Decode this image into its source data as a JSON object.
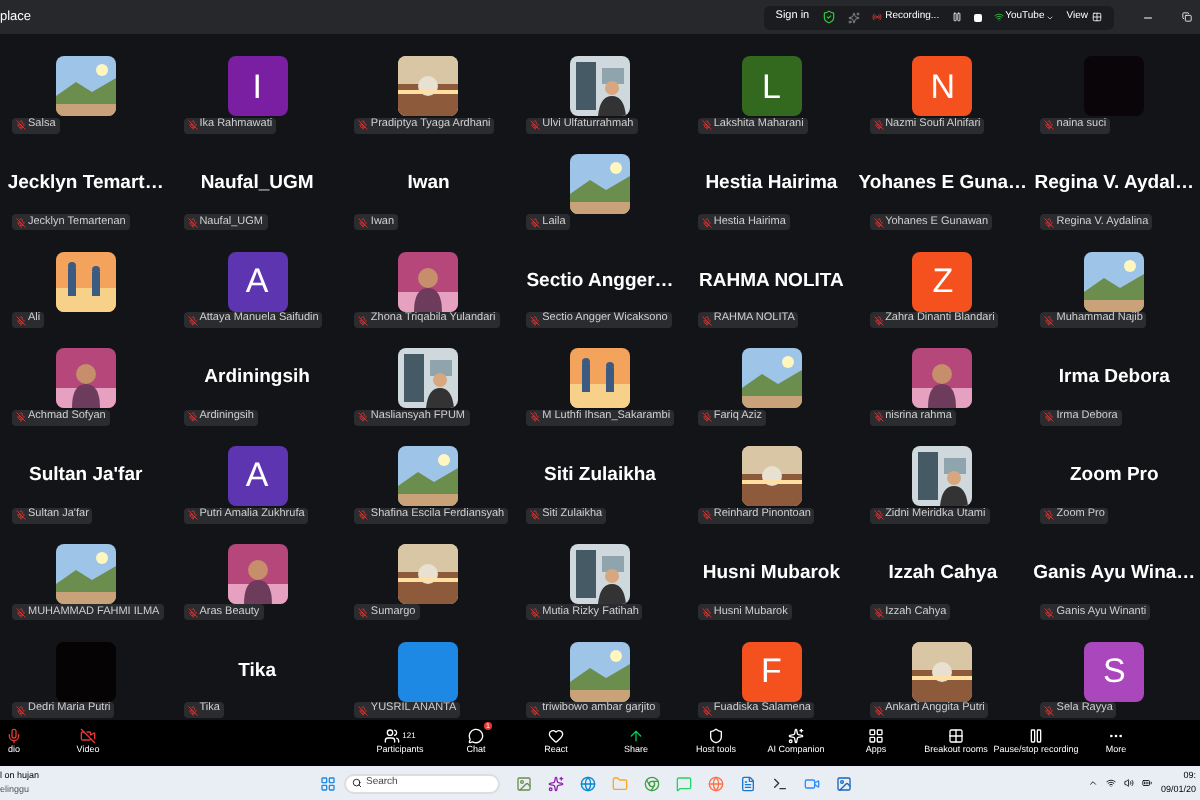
{
  "window": {
    "title": "place"
  },
  "meeting_bar": {
    "sign_in": "Sign in",
    "recording": "Recording...",
    "stream": "YouTube",
    "view": "View"
  },
  "tiles": [
    {
      "kind": "picture",
      "label": "Salsa"
    },
    {
      "kind": "avatar",
      "letter": "I",
      "color": "#7b1fa2",
      "label": "Ika Rahmawati"
    },
    {
      "kind": "picture",
      "label": "Pradiptya Tyaga Ardhani"
    },
    {
      "kind": "picture",
      "label": "Ulvi Ulfaturrahmah"
    },
    {
      "kind": "avatar",
      "letter": "L",
      "color": "#33691e",
      "label": "Lakshita Maharani"
    },
    {
      "kind": "avatar",
      "letter": "N",
      "color": "#f4511e",
      "label": "Nazmi Soufi Alnifari"
    },
    {
      "kind": "blank",
      "color": "#0a0508",
      "label": "naina suci"
    },
    {
      "kind": "name",
      "name": "Jecklyn Temart…",
      "label": "Jecklyn Temartenan"
    },
    {
      "kind": "name",
      "name": "Naufal_UGM",
      "label": "Naufal_UGM"
    },
    {
      "kind": "name",
      "name": "Iwan",
      "label": "Iwan"
    },
    {
      "kind": "picture",
      "label": "Laila"
    },
    {
      "kind": "name",
      "name": "Hestia Hairima",
      "label": "Hestia Hairima"
    },
    {
      "kind": "name",
      "name": "Yohanes E Guna…",
      "label": "Yohanes E Gunawan"
    },
    {
      "kind": "name",
      "name": "Regina V. Aydal…",
      "label": "Regina V. Aydalina"
    },
    {
      "kind": "picture",
      "label": "Ali"
    },
    {
      "kind": "avatar",
      "letter": "A",
      "color": "#5e35b1",
      "label": "Attaya Manuela Saifudin"
    },
    {
      "kind": "picture",
      "label": "Zhona Triqabila Yulandari"
    },
    {
      "kind": "name",
      "name": "Sectio Angger…",
      "label": "Sectio Angger Wicaksono"
    },
    {
      "kind": "name",
      "name": "RAHMA NOLITA",
      "label": "RAHMA NOLITA"
    },
    {
      "kind": "avatar",
      "letter": "Z",
      "color": "#f4511e",
      "label": "Zahra Dinanti Blandari"
    },
    {
      "kind": "picture",
      "label": "Muhammad Najib"
    },
    {
      "kind": "picture",
      "label": "Achmad Sofyan"
    },
    {
      "kind": "name",
      "name": "Ardiningsih",
      "label": "Ardiningsih"
    },
    {
      "kind": "picture",
      "label": "Nasliansyah FPUM"
    },
    {
      "kind": "picture",
      "label": "M Luthfi Ihsan_Sakarambi"
    },
    {
      "kind": "picture",
      "label": "Fariq Aziz"
    },
    {
      "kind": "picture",
      "label": "nisrina rahma"
    },
    {
      "kind": "name",
      "name": "Irma Debora",
      "label": "Irma Debora"
    },
    {
      "kind": "name",
      "name": "Sultan Ja'far",
      "label": "Sultan Ja'far"
    },
    {
      "kind": "avatar",
      "letter": "A",
      "color": "#5e35b1",
      "label": "Putri Amalia Zukhrufa"
    },
    {
      "kind": "picture",
      "label": "Shafina Escila Ferdiansyah"
    },
    {
      "kind": "name",
      "name": "Siti Zulaikha",
      "label": "Siti Zulaikha"
    },
    {
      "kind": "picture",
      "label": "Reinhard Pinontoan"
    },
    {
      "kind": "picture",
      "label": "Zidni Meiridka Utami"
    },
    {
      "kind": "name",
      "name": "Zoom Pro",
      "label": "Zoom Pro"
    },
    {
      "kind": "picture",
      "label": "MUHAMMAD FAHMI ILMA"
    },
    {
      "kind": "picture",
      "label": "Aras Beauty"
    },
    {
      "kind": "picture",
      "label": "Sumargo"
    },
    {
      "kind": "picture",
      "label": "Mutia Rizky Fatihah"
    },
    {
      "kind": "name",
      "name": "Husni Mubarok",
      "label": "Husni Mubarok"
    },
    {
      "kind": "name",
      "name": "Izzah Cahya",
      "label": "Izzah Cahya"
    },
    {
      "kind": "name",
      "name": "Ganis Ayu Wina…",
      "label": "Ganis Ayu Winanti"
    },
    {
      "kind": "blank",
      "color": "#050303",
      "label": "Dedri Maria Putri"
    },
    {
      "kind": "name",
      "name": "Tika",
      "label": "Tika"
    },
    {
      "kind": "blank",
      "color": "#1e88e5",
      "label": "YUSRIL ANANTA"
    },
    {
      "kind": "picture",
      "label": "triwibowo ambar garjito"
    },
    {
      "kind": "avatar",
      "letter": "F",
      "color": "#f4511e",
      "label": "Fuadiska Salamena"
    },
    {
      "kind": "picture",
      "label": "Ankarti Anggita Putri"
    },
    {
      "kind": "avatar",
      "letter": "S",
      "color": "#ab47bc",
      "label": "Sela Rayya"
    }
  ],
  "toolbar": [
    {
      "label": "dio"
    },
    {
      "label": "Video"
    },
    {
      "label": "Participants",
      "count": "121"
    },
    {
      "label": "Chat",
      "badge": "1"
    },
    {
      "label": "React"
    },
    {
      "label": "Share"
    },
    {
      "label": "Host tools"
    },
    {
      "label": "AI Companion"
    },
    {
      "label": "Apps"
    },
    {
      "label": "Breakout rooms"
    },
    {
      "label": "Pause/stop recording"
    },
    {
      "label": "More"
    }
  ],
  "taskbar": {
    "weather_1": "l on hujan",
    "weather_2": "elinggu",
    "search": "Search",
    "time": "09:",
    "date": "09/01/20"
  }
}
